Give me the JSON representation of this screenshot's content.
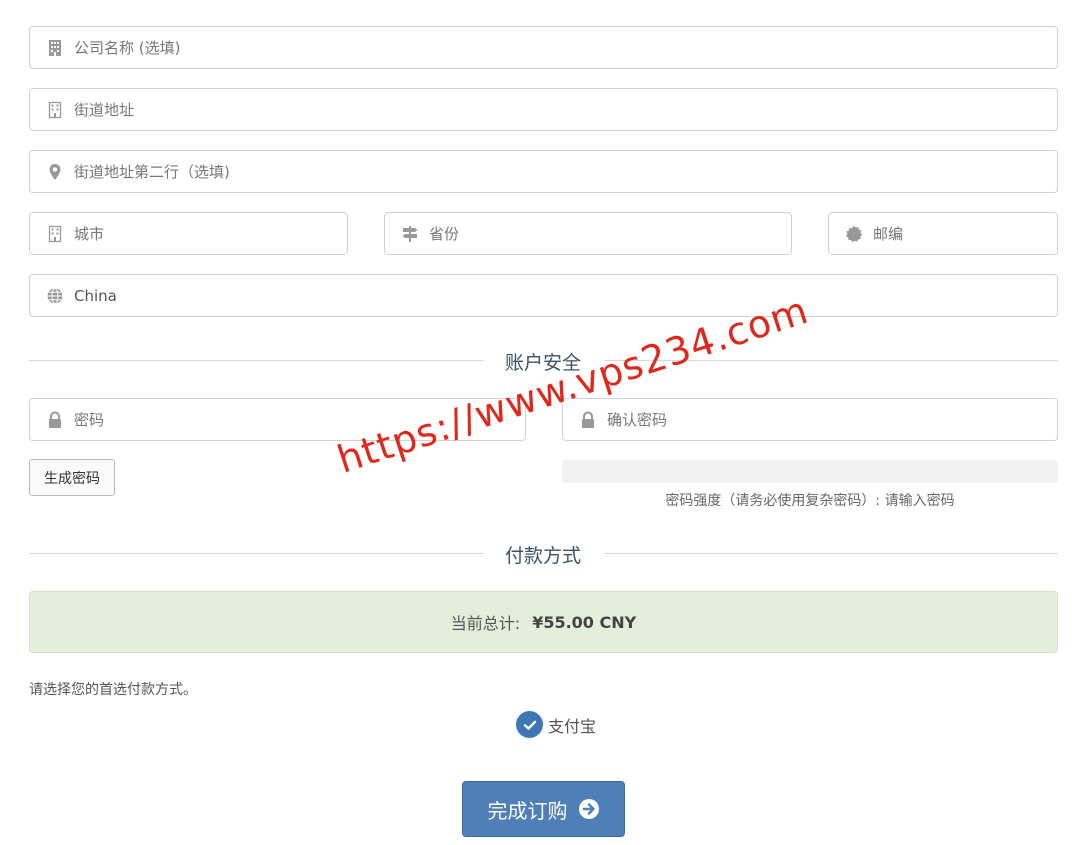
{
  "address": {
    "company_placeholder": "公司名称 (选填)",
    "street_placeholder": "街道地址",
    "street2_placeholder": "街道地址第二行（选填)",
    "city_placeholder": "城市",
    "state_placeholder": "省份",
    "postcode_placeholder": "邮编",
    "country_value": "China"
  },
  "security": {
    "title": "账户安全",
    "password_placeholder": "密码",
    "confirm_placeholder": "确认密码",
    "generate_label": "生成密码",
    "strength_text": "密码强度（请务必使用复杂密码）: 请输入密码"
  },
  "payment": {
    "title": "付款方式",
    "total_label": "当前总计:",
    "total_amount": "¥55.00 CNY",
    "hint": "请选择您的首选付款方式。",
    "option_label": "支付宝"
  },
  "submit_label": "完成订购",
  "watermark": "https://www.vps234.com",
  "colors": {
    "accent": "#4f7fb7",
    "total_bg": "#e3efda",
    "watermark": "#e1261c"
  }
}
